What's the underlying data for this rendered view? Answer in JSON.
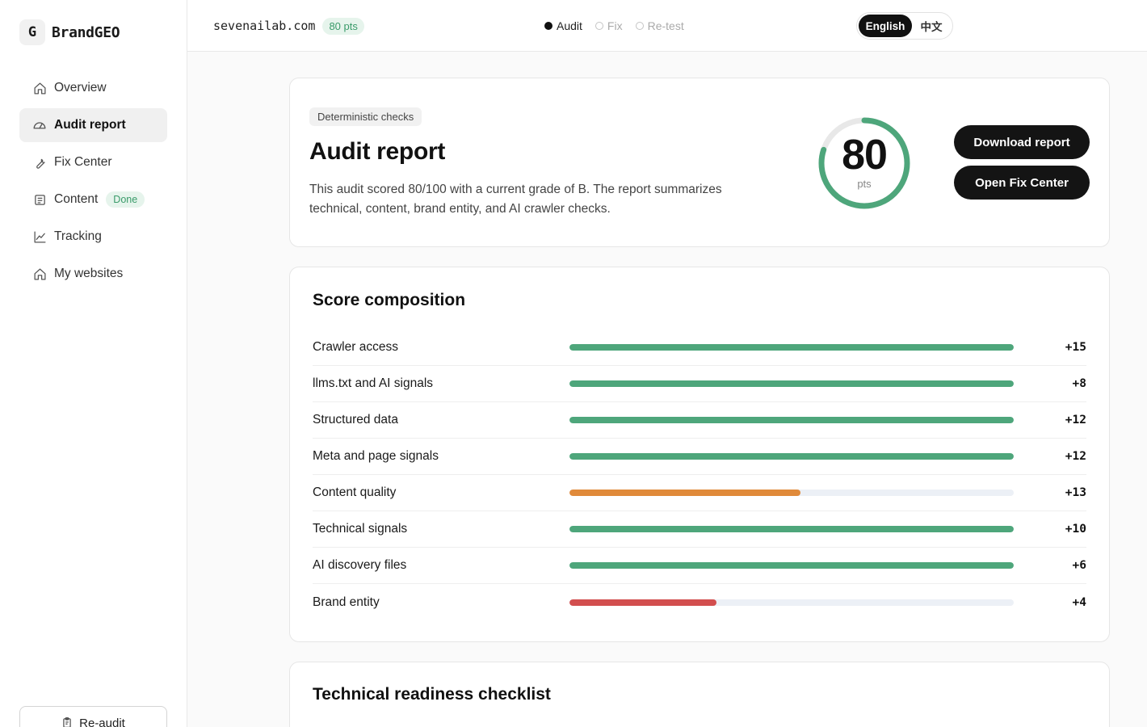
{
  "brand": {
    "mark": "G",
    "name": "BrandGEO"
  },
  "sidebar": {
    "items": [
      {
        "label": "Overview",
        "icon": "home-icon",
        "active": false
      },
      {
        "label": "Audit report",
        "icon": "gauge-icon",
        "active": true
      },
      {
        "label": "Fix Center",
        "icon": "wrench-icon",
        "active": false
      },
      {
        "label": "Content",
        "icon": "document-icon",
        "active": false,
        "badge": "Done"
      },
      {
        "label": "Tracking",
        "icon": "trend-chart-icon",
        "active": false
      },
      {
        "label": "My websites",
        "icon": "home-icon",
        "active": false
      }
    ],
    "reaudit_label": "Re-audit",
    "reaudit_icon": "clipboard-icon"
  },
  "topbar": {
    "domain": "sevenailab.com",
    "pts_badge": "80 pts",
    "steps": [
      {
        "label": "Audit",
        "active": true
      },
      {
        "label": "Fix",
        "active": false
      },
      {
        "label": "Re-test",
        "active": false
      }
    ],
    "lang": {
      "selected": "English",
      "alternate": "中文"
    }
  },
  "hero": {
    "chip": "Deterministic checks",
    "title": "Audit report",
    "description": "This audit scored 80/100 with a current grade of B. The report summarizes technical, content, brand entity, and AI crawler checks.",
    "score": "80",
    "score_max": 100,
    "score_unit": "pts",
    "download_label": "Download report",
    "fix_label": "Open Fix Center"
  },
  "composition": {
    "title": "Score composition",
    "rows": [
      {
        "label": "Crawler access",
        "value": "+15",
        "fill": 1.0,
        "color": "#4ea67b"
      },
      {
        "label": "llms.txt and AI signals",
        "value": "+8",
        "fill": 1.0,
        "color": "#4ea67b"
      },
      {
        "label": "Structured data",
        "value": "+12",
        "fill": 1.0,
        "color": "#4ea67b"
      },
      {
        "label": "Meta and page signals",
        "value": "+12",
        "fill": 1.0,
        "color": "#4ea67b"
      },
      {
        "label": "Content quality",
        "value": "+13",
        "fill": 0.52,
        "color": "#e08a3a"
      },
      {
        "label": "Technical signals",
        "value": "+10",
        "fill": 1.0,
        "color": "#4ea67b"
      },
      {
        "label": "AI discovery files",
        "value": "+6",
        "fill": 1.0,
        "color": "#4ea67b"
      },
      {
        "label": "Brand entity",
        "value": "+4",
        "fill": 0.33,
        "color": "#d24e4e"
      }
    ]
  },
  "checklist": {
    "title": "Technical readiness checklist"
  },
  "colors": {
    "accent_green": "#4ea67b",
    "warning_orange": "#e08a3a",
    "danger_red": "#d24e4e",
    "primary_dark": "#141414"
  }
}
